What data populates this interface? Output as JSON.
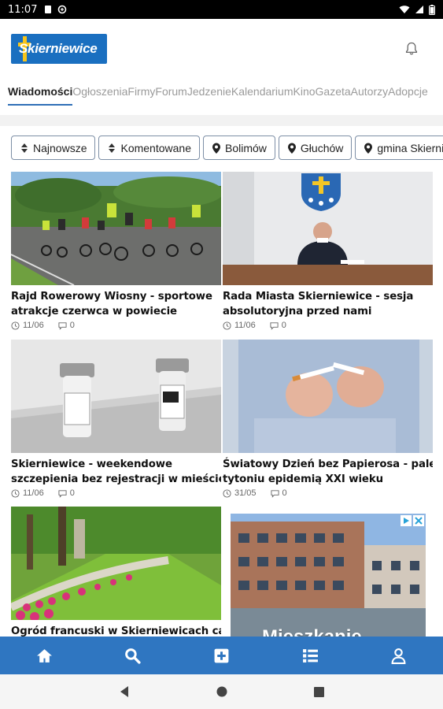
{
  "status_bar": {
    "time": "11:07"
  },
  "app": {
    "logo_text": "Skierniewice"
  },
  "tabs": [
    {
      "label": "Wiadomości",
      "active": true
    },
    {
      "label": "Ogłoszenia"
    },
    {
      "label": "Firmy"
    },
    {
      "label": "Forum"
    },
    {
      "label": "Jedzenie"
    },
    {
      "label": "Kalendarium"
    },
    {
      "label": "Kino"
    },
    {
      "label": "Gazeta"
    },
    {
      "label": "Autorzy"
    },
    {
      "label": "Adopcje"
    }
  ],
  "filters": [
    {
      "label": "Najnowsze",
      "icon": "sort-icon"
    },
    {
      "label": "Komentowane",
      "icon": "sort-icon"
    },
    {
      "label": "Bolimów",
      "icon": "map-pin-icon"
    },
    {
      "label": "Głuchów",
      "icon": "map-pin-icon"
    },
    {
      "label": "gmina Skierniewice",
      "icon": "map-pin-icon"
    }
  ],
  "articles": [
    {
      "title_line1": "Rajd Rowerowy Wiosny - sportowe",
      "title_line2": "atrakcje czerwca w powiecie",
      "date": "11/06",
      "comments": "0"
    },
    {
      "title_line1": "Rada Miasta Skierniewice - sesja",
      "title_line2": "absolutoryjna przed nami",
      "date": "11/06",
      "comments": "0"
    },
    {
      "title_line1": "Skierniewice - weekendowe",
      "title_line2": "szczepienia bez rejestracji w mieście",
      "date": "11/06",
      "comments": "0"
    },
    {
      "title_line1": "Światowy Dzień bez Papierosa - palenie",
      "title_line2": "tytoniu epidemią XXI wieku",
      "date": "31/05",
      "comments": "0"
    },
    {
      "title_line1": "Ogród francuski w Skierniewicach cały",
      "title_line2": "",
      "date": "",
      "comments": ""
    }
  ],
  "ad": {
    "text": "Mieszkanie"
  },
  "bottom_nav": [
    "home-icon",
    "search-icon",
    "add-icon",
    "list-icon",
    "user-icon"
  ],
  "colors": {
    "accent": "#2f76c1",
    "tab_underline": "#2f6fb7",
    "logo_bg": "#1a6fc0",
    "logo_cross": "#f7c51b"
  }
}
